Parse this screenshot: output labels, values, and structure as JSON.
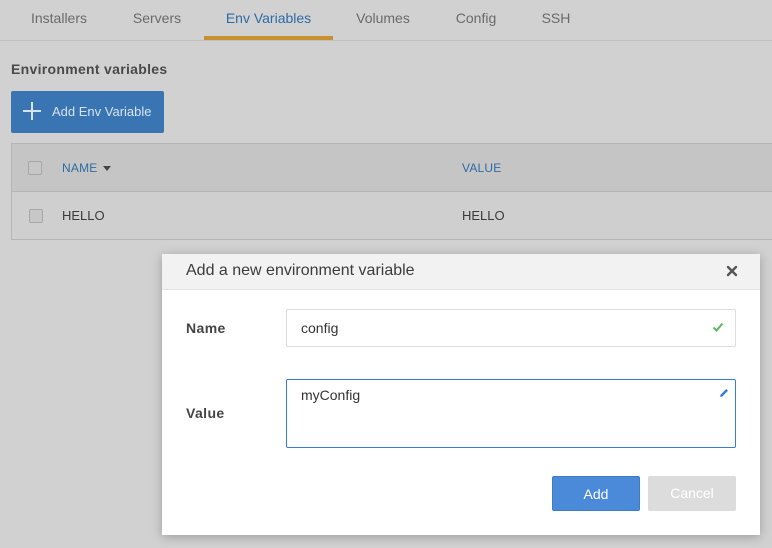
{
  "tabs": [
    {
      "label": "Installers"
    },
    {
      "label": "Servers"
    },
    {
      "label": "Env Variables",
      "active": true
    },
    {
      "label": "Volumes"
    },
    {
      "label": "Config"
    },
    {
      "label": "SSH"
    }
  ],
  "section": {
    "title": "Environment variables",
    "add_button_label": "Add Env Variable",
    "add_button_icon": "plus-icon"
  },
  "table": {
    "columns": [
      "NAME",
      "VALUE"
    ],
    "rows": [
      {
        "name": "HELLO",
        "value": "HELLO"
      }
    ]
  },
  "modal": {
    "title": "Add a new environment variable",
    "name_label": "Name",
    "name_value": "config",
    "value_label": "Value",
    "value_value": "myConfig",
    "add_label": "Add",
    "cancel_label": "Cancel"
  },
  "colors": {
    "accent": "#4a8ad8",
    "tab_active_underline": "#c9902e",
    "valid": "#5cb85c"
  }
}
